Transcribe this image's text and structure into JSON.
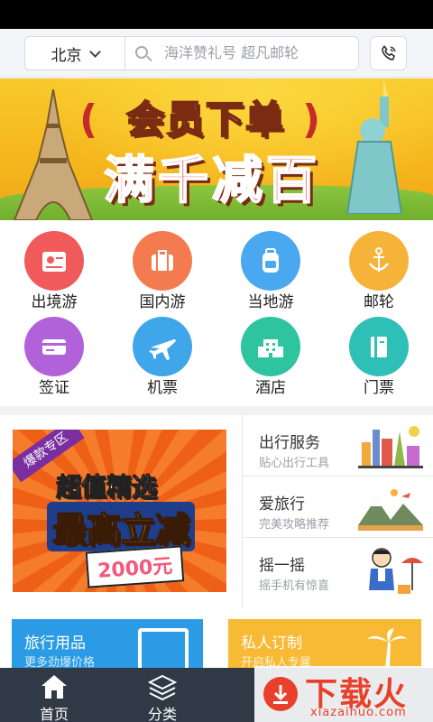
{
  "header": {
    "city": "北京",
    "search_placeholder": "海洋赞礼号 超凡邮轮"
  },
  "banner": {
    "line1": "会员下单",
    "line2": "满千减百",
    "slides": 4,
    "active_slide": 1
  },
  "categories": [
    {
      "label": "出境游",
      "color": "#f05a5a",
      "icon": "passport-icon"
    },
    {
      "label": "国内游",
      "color": "#f37b4f",
      "icon": "suitcase-icon"
    },
    {
      "label": "当地游",
      "color": "#4aa8f0",
      "icon": "backpack-icon"
    },
    {
      "label": "邮轮",
      "color": "#f6b33a",
      "icon": "anchor-icon"
    },
    {
      "label": "签证",
      "color": "#b262d9",
      "icon": "visa-card-icon"
    },
    {
      "label": "机票",
      "color": "#3fa6ea",
      "icon": "airplane-icon"
    },
    {
      "label": "酒店",
      "color": "#2ec4a0",
      "icon": "hotel-icon"
    },
    {
      "label": "门票",
      "color": "#2ebfb6",
      "icon": "ticket-icon"
    }
  ],
  "promo": {
    "tag": "爆款专区",
    "line1": "超值精选",
    "line2": "最高立减",
    "amount": "2000元"
  },
  "services": [
    {
      "title": "出行服务",
      "subtitle": "贴心出行工具",
      "icon": "city-landmarks-icon"
    },
    {
      "title": "爱旅行",
      "subtitle": "完美攻略推荐",
      "icon": "mountains-icon"
    },
    {
      "title": "摇一摇",
      "subtitle": "摇手机有惊喜",
      "icon": "traveler-icon"
    }
  ],
  "cards": [
    {
      "title": "旅行用品",
      "subtitle": "更多劲爆价格",
      "color": "#2a9be4"
    },
    {
      "title": "私人订制",
      "subtitle": "开启私人专属",
      "color": "#f8b934"
    }
  ],
  "tabs": [
    {
      "label": "首页",
      "icon": "home-icon"
    },
    {
      "label": "分类",
      "icon": "layers-icon"
    }
  ],
  "watermark": {
    "title": "下载火",
    "url": "xiazaihuo.com"
  }
}
